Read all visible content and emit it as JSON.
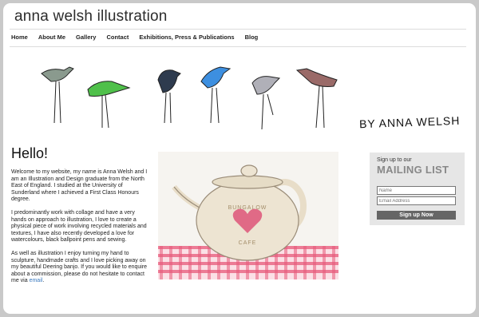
{
  "site": {
    "title": "anna welsh illustration"
  },
  "nav": {
    "items": [
      "Home",
      "About Me",
      "Gallery",
      "Contact",
      "Exhibitions, Press & Publications",
      "Blog"
    ]
  },
  "banner": {
    "signature": "BY ANNA WELSH"
  },
  "content": {
    "heading": "Hello!",
    "para1": "Welcome to my website, my name is Anna Welsh and I am an Illustration and Design graduate from the North East of England. I studied at the University of Sunderland where I achieved a First Class Honours degree.",
    "para2": "I predominantly work with collage and have a very hands on approach to illustration, I love to create a physical piece of work involving recycled materials and textures, I have also recently developed a love for watercolours, black ballpoint pens and sewing.",
    "para3": "As well as illustration I enjoy turning my hand to sculpture, handmade crafts and I love picking away on my beautiful Deering banjo. If you would like to enquire about a commission, please do not hesitate to contact me via",
    "email_link": "email",
    "period": "."
  },
  "teapot": {
    "label_top": "BUNGALOW",
    "label_bottom": "CAFE"
  },
  "mailing": {
    "pre": "Sign up to our",
    "title": "MAILING LIST",
    "name_placeholder": "Name",
    "email_placeholder": "Email Address",
    "button": "Sign up Now"
  },
  "colors": {
    "accent_link": "#3a7abf",
    "button": "#666666",
    "panel": "#e6e6e6",
    "heart": "#e06a86",
    "tablecloth": "#e85a7a"
  }
}
